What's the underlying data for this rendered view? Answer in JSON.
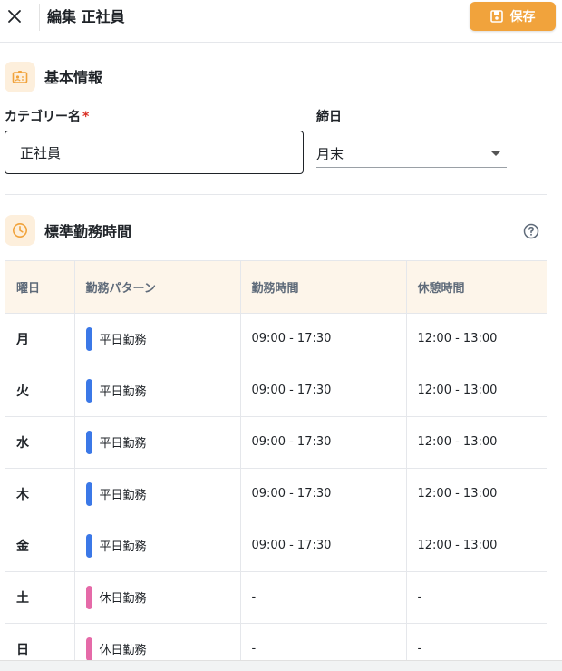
{
  "header": {
    "title": "編集 正社員",
    "save_label": "保存"
  },
  "basic_info": {
    "title": "基本情報",
    "category_label": "カテゴリー名",
    "required_mark": "*",
    "category_value": "正社員",
    "closing_label": "締日",
    "closing_value": "月末"
  },
  "schedule": {
    "title": "標準勤務時間",
    "columns": [
      "曜日",
      "勤務パターン",
      "勤務時間",
      "休憩時間"
    ],
    "rows": [
      {
        "day": "月",
        "pattern": "平日勤務",
        "pattern_color": "#3b78e7",
        "work": "09:00 - 17:30",
        "break": "12:00 - 13:00"
      },
      {
        "day": "火",
        "pattern": "平日勤務",
        "pattern_color": "#3b78e7",
        "work": "09:00 - 17:30",
        "break": "12:00 - 13:00"
      },
      {
        "day": "水",
        "pattern": "平日勤務",
        "pattern_color": "#3b78e7",
        "work": "09:00 - 17:30",
        "break": "12:00 - 13:00"
      },
      {
        "day": "木",
        "pattern": "平日勤務",
        "pattern_color": "#3b78e7",
        "work": "09:00 - 17:30",
        "break": "12:00 - 13:00"
      },
      {
        "day": "金",
        "pattern": "平日勤務",
        "pattern_color": "#3b78e7",
        "work": "09:00 - 17:30",
        "break": "12:00 - 13:00"
      },
      {
        "day": "土",
        "pattern": "休日勤務",
        "pattern_color": "#e56aa8",
        "work": "-",
        "break": "-"
      },
      {
        "day": "日",
        "pattern": "休日勤務",
        "pattern_color": "#e56aa8",
        "work": "-",
        "break": "-"
      }
    ]
  },
  "colors": {
    "accent": "#f1a33c",
    "icon_bg": "#fdefdc",
    "weekday": "#3b78e7",
    "holiday": "#e56aa8"
  },
  "icons": {
    "close": "close-icon",
    "save": "floppy-disk-icon",
    "basic_info": "id-card-icon",
    "schedule": "clock-icon",
    "help": "help-circle-icon",
    "dropdown": "caret-down-icon"
  }
}
